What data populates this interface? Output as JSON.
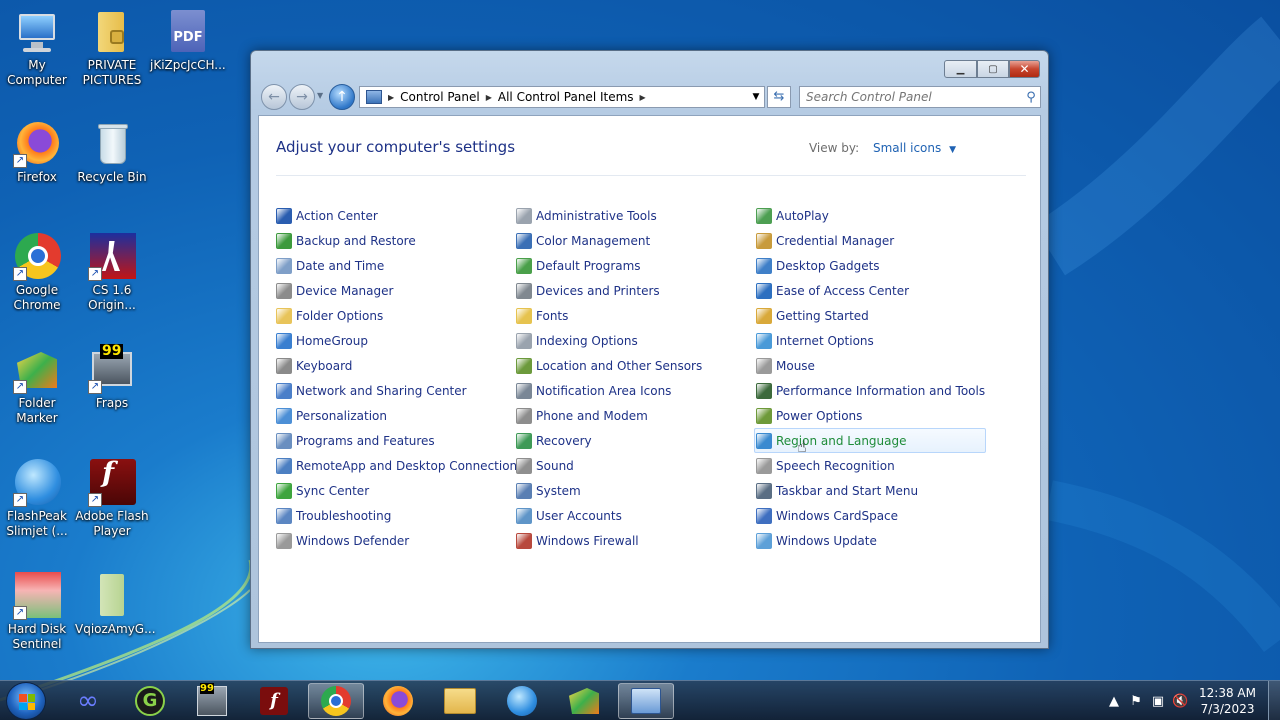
{
  "desktop": {
    "icons": [
      {
        "label": "My Computer"
      },
      {
        "label": "PRIVATE PICTURES"
      },
      {
        "label": "jKiZpcJcCH..."
      },
      {
        "label": "Firefox"
      },
      {
        "label": "Recycle Bin"
      },
      {
        "label": "Google Chrome"
      },
      {
        "label": "CS 1.6 Origin..."
      },
      {
        "label": "Folder Marker"
      },
      {
        "label": "Fraps"
      },
      {
        "label": "FlashPeak Slimjet (..."
      },
      {
        "label": "Adobe Flash Player"
      },
      {
        "label": "Hard Disk Sentinel"
      },
      {
        "label": "VqiozAmyG..."
      }
    ]
  },
  "window": {
    "breadcrumb": [
      "Control Panel",
      "All Control Panel Items"
    ],
    "search_placeholder": "Search Control Panel",
    "heading": "Adjust your computer's settings",
    "view_by_label": "View by:",
    "view_by_value": "Small icons",
    "columns": [
      [
        {
          "label": "Action Center",
          "color": "#2a5db0"
        },
        {
          "label": "Backup and Restore",
          "color": "#3d9a3d"
        },
        {
          "label": "Date and Time",
          "color": "#7f9fc8"
        },
        {
          "label": "Device Manager",
          "color": "#8c8c8c"
        },
        {
          "label": "Folder Options",
          "color": "#e8c45a"
        },
        {
          "label": "HomeGroup",
          "color": "#3a7fd0"
        },
        {
          "label": "Keyboard",
          "color": "#8a8a8a"
        },
        {
          "label": "Network and Sharing Center",
          "color": "#4b7fc9"
        },
        {
          "label": "Personalization",
          "color": "#4c8fd6"
        },
        {
          "label": "Programs and Features",
          "color": "#6a8fc0"
        },
        {
          "label": "RemoteApp and Desktop Connections",
          "color": "#4c7fc2"
        },
        {
          "label": "Sync Center",
          "color": "#3ea53e"
        },
        {
          "label": "Troubleshooting",
          "color": "#5b86c2"
        },
        {
          "label": "Windows Defender",
          "color": "#9a9a9a"
        }
      ],
      [
        {
          "label": "Administrative Tools",
          "color": "#9aa3ae"
        },
        {
          "label": "Color Management",
          "color": "#3b6fb5"
        },
        {
          "label": "Default Programs",
          "color": "#4aa04a"
        },
        {
          "label": "Devices and Printers",
          "color": "#808890"
        },
        {
          "label": "Fonts",
          "color": "#e6c34f"
        },
        {
          "label": "Indexing Options",
          "color": "#9aa3ae"
        },
        {
          "label": "Location and Other Sensors",
          "color": "#6c9a3c"
        },
        {
          "label": "Notification Area Icons",
          "color": "#7a8796"
        },
        {
          "label": "Phone and Modem",
          "color": "#8d8d8d"
        },
        {
          "label": "Recovery",
          "color": "#3f9a57"
        },
        {
          "label": "Sound",
          "color": "#8f8f8f"
        },
        {
          "label": "System",
          "color": "#5a7fb3"
        },
        {
          "label": "User Accounts",
          "color": "#5f95c8"
        },
        {
          "label": "Windows Firewall",
          "color": "#b8493d"
        }
      ],
      [
        {
          "label": "AutoPlay",
          "color": "#4d9f52"
        },
        {
          "label": "Credential Manager",
          "color": "#c89b3c"
        },
        {
          "label": "Desktop Gadgets",
          "color": "#3f7fc8"
        },
        {
          "label": "Ease of Access Center",
          "color": "#2d6fc0"
        },
        {
          "label": "Getting Started",
          "color": "#d9a93a"
        },
        {
          "label": "Internet Options",
          "color": "#4a9ad8"
        },
        {
          "label": "Mouse",
          "color": "#9a9a9a"
        },
        {
          "label": "Performance Information and Tools",
          "color": "#3c6a3c"
        },
        {
          "label": "Power Options",
          "color": "#6e9a3a"
        },
        {
          "label": "Region and Language",
          "color": "#3a8ad0"
        },
        {
          "label": "Speech Recognition",
          "color": "#9a9a9a"
        },
        {
          "label": "Taskbar and Start Menu",
          "color": "#5a6e84"
        },
        {
          "label": "Windows CardSpace",
          "color": "#3f6fc0"
        },
        {
          "label": "Windows Update",
          "color": "#5da0d8"
        }
      ]
    ],
    "hovered_item": "Region and Language"
  },
  "taskbar": {
    "clock_time": "12:38 AM",
    "clock_date": "7/3/2023"
  }
}
